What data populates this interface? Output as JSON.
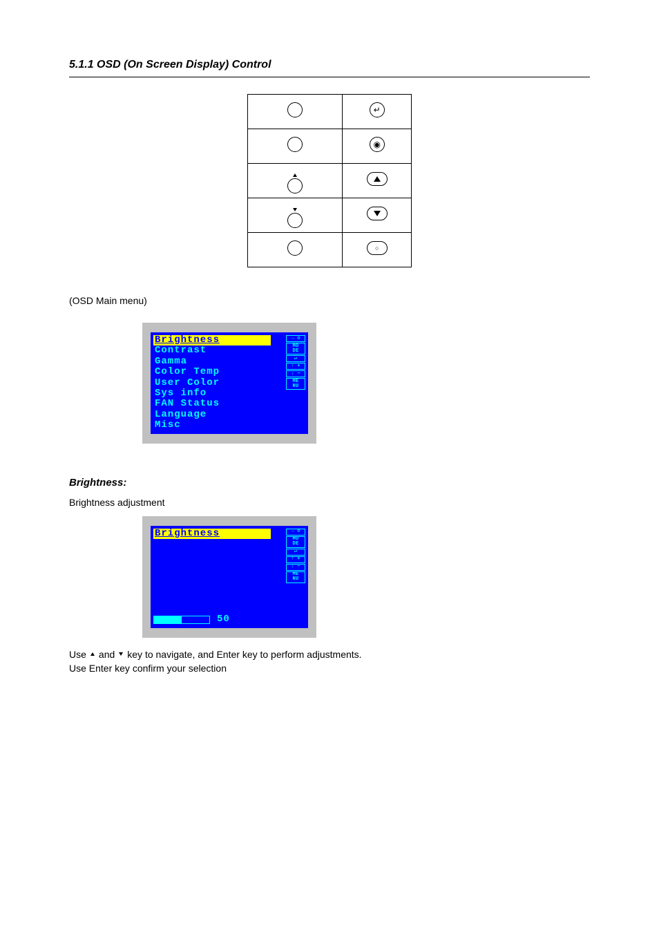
{
  "section": {
    "heading": "5.1.1 OSD (On Screen Display) Control"
  },
  "osd_intro": "(OSD Main menu)",
  "osd_menu": {
    "items": [
      {
        "label": "Brightness",
        "selected": true
      },
      {
        "label": "Contrast",
        "selected": false
      },
      {
        "label": "Gamma",
        "selected": false
      },
      {
        "label": "Color Temp",
        "selected": false
      },
      {
        "label": "User Color",
        "selected": false
      },
      {
        "label": "Sys info",
        "selected": false
      },
      {
        "label": "FAN Status",
        "selected": false
      },
      {
        "label": "Language",
        "selected": false
      },
      {
        "label": "Misc",
        "selected": false
      }
    ],
    "legend": [
      "→ ⚙",
      "MO\nDE",
      "↵",
      "↑ +",
      "↓ −",
      "ME\nNU"
    ]
  },
  "brightness": {
    "heading": "Brightness:",
    "intro": "Brightness adjustment",
    "title": "Brightness",
    "value": 50,
    "value_text": "50",
    "fill_pct": "50%"
  },
  "nav": {
    "line1_pre": "Use ",
    "line1_mid": " and ",
    "line1_post": " key to navigate, and Enter key to perform adjustments.",
    "line2": "Use Enter key confirm your selection"
  }
}
